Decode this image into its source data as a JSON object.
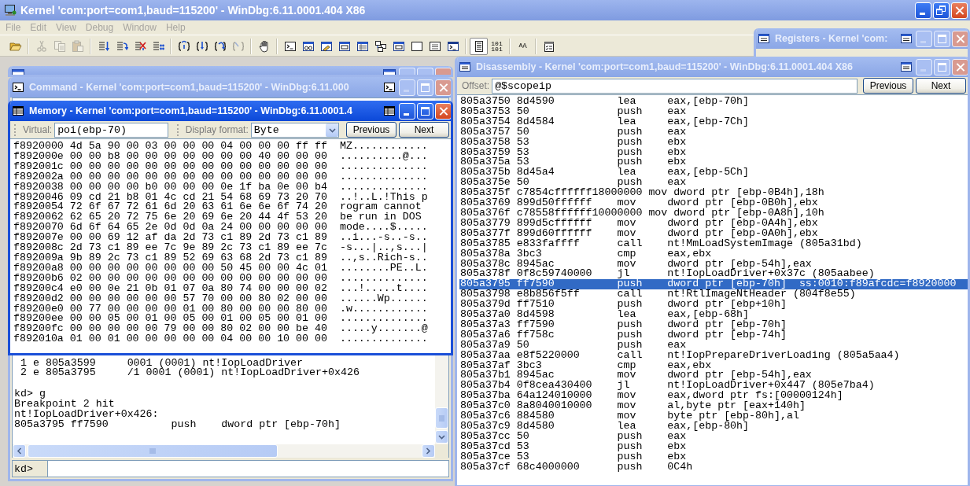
{
  "window": {
    "title": "Kernel 'com:port=com1,baud=115200' - WinDbg:6.11.0001.404 X86"
  },
  "menu": [
    "File",
    "Edit",
    "View",
    "Debug",
    "Window",
    "Help"
  ],
  "toolbar": [
    [
      {
        "disabled": false,
        "pressed": false
      }
    ],
    [
      {
        "disabled": true,
        "pressed": false
      },
      {
        "disabled": true,
        "pressed": false
      },
      {
        "disabled": true,
        "pressed": false
      }
    ],
    [
      {
        "disabled": false,
        "pressed": false
      },
      {
        "disabled": false,
        "pressed": false
      },
      {
        "disabled": false,
        "pressed": false
      },
      {
        "disabled": false,
        "pressed": false
      }
    ],
    [
      {
        "disabled": false,
        "pressed": false
      },
      {
        "disabled": false,
        "pressed": false
      },
      {
        "disabled": false,
        "pressed": false
      },
      {
        "disabled": true,
        "pressed": false
      }
    ],
    [
      {
        "disabled": false,
        "pressed": false
      }
    ],
    [
      {
        "disabled": false,
        "pressed": false
      },
      {
        "disabled": false,
        "pressed": false
      },
      {
        "disabled": false,
        "pressed": false
      },
      {
        "disabled": false,
        "pressed": false
      },
      {
        "disabled": false,
        "pressed": false
      },
      {
        "disabled": false,
        "pressed": false
      },
      {
        "disabled": false,
        "pressed": false
      },
      {
        "disabled": false,
        "pressed": false
      },
      {
        "disabled": false,
        "pressed": false
      },
      {
        "disabled": false,
        "pressed": false
      }
    ],
    [
      {
        "disabled": false,
        "pressed": true
      },
      {
        "disabled": false,
        "pressed": false,
        "text": "101 101"
      }
    ],
    [
      {
        "disabled": false,
        "pressed": false,
        "text": "A$_{A}$"
      }
    ],
    [
      {
        "disabled": false,
        "pressed": false
      }
    ]
  ],
  "scratch_pad": {
    "active": false
  },
  "command": {
    "title": "Command - Kernel 'com:port=com1,baud=115200' - WinDbg:6.11.000",
    "active": false,
    "output": [
      [
        " 1 e 805a3599     0001 (0001) nt!IopLoadDriver",
        " 2 e 805a3795     /1 0001 (0001) nt!IopLoadDriver+0x426"
      ],
      [
        "kd> g",
        "Breakpoint 2 hit",
        "nt!IopLoadDriver+0x426:",
        "805a3795 ff7590          push    dword ptr [ebp-70h]"
      ]
    ],
    "prompt": "kd>"
  },
  "memory": {
    "title": "Memory - Kernel 'com:port=com1,baud=115200' - WinDbg:6.11.0001.4",
    "active": true,
    "virtual_label": "Virtual:",
    "virtual": "poi(ebp-70)",
    "format_label": "Display format:",
    "format": "Byte",
    "buttons": [
      "Previous",
      "Next"
    ],
    "rows": [
      {
        "address": "f8920000",
        "bytes": "4d 5a 90 00 03 00 00 00 04 00 00 00 ff ff",
        "ascii": "MZ............"
      },
      {
        "address": "f892000e",
        "bytes": "00 00 b8 00 00 00 00 00 00 00 40 00 00 00",
        "ascii": "..........@..."
      },
      {
        "address": "f892001c",
        "bytes": "00 00 00 00 00 00 00 00 00 00 00 00 00 00",
        "ascii": ".............."
      },
      {
        "address": "f892002a",
        "bytes": "00 00 00 00 00 00 00 00 00 00 00 00 00 00",
        "ascii": ".............."
      },
      {
        "address": "f8920038",
        "bytes": "00 00 00 00 b0 00 00 00 0e 1f ba 0e 00 b4",
        "ascii": ".............."
      },
      {
        "address": "f8920046",
        "bytes": "09 cd 21 b8 01 4c cd 21 54 68 69 73 20 70",
        "ascii": "..!..L.!This p"
      },
      {
        "address": "f8920054",
        "bytes": "72 6f 67 72 61 6d 20 63 61 6e 6e 6f 74 20",
        "ascii": "rogram cannot"
      },
      {
        "address": "f8920062",
        "bytes": "62 65 20 72 75 6e 20 69 6e 20 44 4f 53 20",
        "ascii": "be run in DOS"
      },
      {
        "address": "f8920070",
        "bytes": "6d 6f 64 65 2e 0d 0d 0a 24 00 00 00 00 00",
        "ascii": "mode....$....."
      },
      {
        "address": "f892007e",
        "bytes": "00 00 69 12 af da 2d 73 c1 89 2d 73 c1 89",
        "ascii": "..i...-s..-s.."
      },
      {
        "address": "f892008c",
        "bytes": "2d 73 c1 89 ee 7c 9e 89 2c 73 c1 89 ee 7c",
        "ascii": "-s...|..,s...|"
      },
      {
        "address": "f892009a",
        "bytes": "9b 89 2c 73 c1 89 52 69 63 68 2d 73 c1 89",
        "ascii": "..,s..Rich-s.."
      },
      {
        "address": "f89200a8",
        "bytes": "00 00 00 00 00 00 00 00 50 45 00 00 4c 01",
        "ascii": "........PE..L."
      },
      {
        "address": "f89200b6",
        "bytes": "02 00 00 00 00 00 00 00 00 00 00 00 00 00",
        "ascii": ".............."
      },
      {
        "address": "f89200c4",
        "bytes": "e0 00 0e 21 0b 01 07 0a 80 74 00 00 00 02",
        "ascii": "...!.....t...."
      },
      {
        "address": "f89200d2",
        "bytes": "00 00 00 00 00 00 57 70 00 00 80 02 00 00",
        "ascii": "......Wp......"
      },
      {
        "address": "f89200e0",
        "bytes": "00 77 00 00 00 00 01 00 80 00 00 00 80 00",
        "ascii": ".w............"
      },
      {
        "address": "f89200ee",
        "bytes": "00 00 05 00 01 00 05 00 01 00 05 00 01 00",
        "ascii": ".............."
      },
      {
        "address": "f89200fc",
        "bytes": "00 00 00 00 00 79 00 00 80 02 00 00 be 40",
        "ascii": ".....y.......@"
      },
      {
        "address": "f892010a",
        "bytes": "01 00 01 00 00 00 00 00 04 00 00 10 00 00",
        "ascii": ".............."
      }
    ]
  },
  "registers": {
    "title": "Registers - Kernel 'com:",
    "active": false
  },
  "disassembly": {
    "title": "Disassembly - Kernel 'com:port=com1,baud=115200' - WinDbg:6.11.0001.404 X86",
    "active": false,
    "offset_label": "Offset:",
    "offset": "@$scopeip",
    "buttons": [
      "Previous",
      "Next"
    ],
    "rows": [
      {
        "address": "805a3750",
        "bytes": "8d4590",
        "mnemonic": "lea",
        "operands": "eax,[ebp-70h]",
        "selected": false
      },
      {
        "address": "805a3753",
        "bytes": "50",
        "mnemonic": "push",
        "operands": "eax",
        "selected": false
      },
      {
        "address": "805a3754",
        "bytes": "8d4584",
        "mnemonic": "lea",
        "operands": "eax,[ebp-7Ch]",
        "selected": false
      },
      {
        "address": "805a3757",
        "bytes": "50",
        "mnemonic": "push",
        "operands": "eax",
        "selected": false
      },
      {
        "address": "805a3758",
        "bytes": "53",
        "mnemonic": "push",
        "operands": "ebx",
        "selected": false
      },
      {
        "address": "805a3759",
        "bytes": "53",
        "mnemonic": "push",
        "operands": "ebx",
        "selected": false
      },
      {
        "address": "805a375a",
        "bytes": "53",
        "mnemonic": "push",
        "operands": "ebx",
        "selected": false
      },
      {
        "address": "805a375b",
        "bytes": "8d45a4",
        "mnemonic": "lea",
        "operands": "eax,[ebp-5Ch]",
        "selected": false
      },
      {
        "address": "805a375e",
        "bytes": "50",
        "mnemonic": "push",
        "operands": "eax",
        "selected": false
      },
      {
        "address": "805a375f",
        "bytes": "c7854cffffff18000000",
        "mnemonic": "mov",
        "operands": "dword ptr [ebp-0B4h],18h",
        "selected": false
      },
      {
        "address": "805a3769",
        "bytes": "899d50ffffff",
        "mnemonic": "mov",
        "operands": "dword ptr [ebp-0B0h],ebx",
        "selected": false
      },
      {
        "address": "805a376f",
        "bytes": "c78558ffffff10000000",
        "mnemonic": "mov",
        "operands": "dword ptr [ebp-0A8h],10h",
        "selected": false
      },
      {
        "address": "805a3779",
        "bytes": "899d5cffffff",
        "mnemonic": "mov",
        "operands": "dword ptr [ebp-0A4h],ebx",
        "selected": false
      },
      {
        "address": "805a377f",
        "bytes": "899d60ffffff",
        "mnemonic": "mov",
        "operands": "dword ptr [ebp-0A0h],ebx",
        "selected": false
      },
      {
        "address": "805a3785",
        "bytes": "e833faffff",
        "mnemonic": "call",
        "operands": "nt!MmLoadSystemImage (805a31bd)",
        "selected": false
      },
      {
        "address": "805a378a",
        "bytes": "3bc3",
        "mnemonic": "cmp",
        "operands": "eax,ebx",
        "selected": false
      },
      {
        "address": "805a378c",
        "bytes": "8945ac",
        "mnemonic": "mov",
        "operands": "dword ptr [ebp-54h],eax",
        "selected": false
      },
      {
        "address": "805a378f",
        "bytes": "0f8c59740000",
        "mnemonic": "jl",
        "operands": "nt!IopLoadDriver+0x37c (805aabee)",
        "selected": false
      },
      {
        "address": "805a3795",
        "bytes": "ff7590",
        "mnemonic": "push",
        "operands": "dword ptr [ebp-70h]",
        "annotation": "ss:0010:f89afcdc=f8920000",
        "selected": true
      },
      {
        "address": "805a3798",
        "bytes": "e8b856f5ff",
        "mnemonic": "call",
        "operands": "nt!RtlImageNtHeader (804f8e55)",
        "selected": false
      },
      {
        "address": "805a379d",
        "bytes": "ff7510",
        "mnemonic": "push",
        "operands": "dword ptr [ebp+10h]",
        "selected": false
      },
      {
        "address": "805a37a0",
        "bytes": "8d4598",
        "mnemonic": "lea",
        "operands": "eax,[ebp-68h]",
        "selected": false
      },
      {
        "address": "805a37a3",
        "bytes": "ff7590",
        "mnemonic": "push",
        "operands": "dword ptr [ebp-70h]",
        "selected": false
      },
      {
        "address": "805a37a6",
        "bytes": "ff758c",
        "mnemonic": "push",
        "operands": "dword ptr [ebp-74h]",
        "selected": false
      },
      {
        "address": "805a37a9",
        "bytes": "50",
        "mnemonic": "push",
        "operands": "eax",
        "selected": false
      },
      {
        "address": "805a37aa",
        "bytes": "e8f5220000",
        "mnemonic": "call",
        "operands": "nt!IopPrepareDriverLoading (805a5aa4)",
        "selected": false
      },
      {
        "address": "805a37af",
        "bytes": "3bc3",
        "mnemonic": "cmp",
        "operands": "eax,ebx",
        "selected": false
      },
      {
        "address": "805a37b1",
        "bytes": "8945ac",
        "mnemonic": "mov",
        "operands": "dword ptr [ebp-54h],eax",
        "selected": false
      },
      {
        "address": "805a37b4",
        "bytes": "0f8cea430400",
        "mnemonic": "jl",
        "operands": "nt!IopLoadDriver+0x447 (805e7ba4)",
        "selected": false
      },
      {
        "address": "805a37ba",
        "bytes": "64a124010000",
        "mnemonic": "mov",
        "operands": "eax,dword ptr fs:[00000124h]",
        "selected": false
      },
      {
        "address": "805a37c0",
        "bytes": "8a8040010000",
        "mnemonic": "mov",
        "operands": "al,byte ptr [eax+140h]",
        "selected": false
      },
      {
        "address": "805a37c6",
        "bytes": "884580",
        "mnemonic": "mov",
        "operands": "byte ptr [ebp-80h],al",
        "selected": false
      },
      {
        "address": "805a37c9",
        "bytes": "8d4580",
        "mnemonic": "lea",
        "operands": "eax,[ebp-80h]",
        "selected": false
      },
      {
        "address": "805a37cc",
        "bytes": "50",
        "mnemonic": "push",
        "operands": "eax",
        "selected": false
      },
      {
        "address": "805a37cd",
        "bytes": "53",
        "mnemonic": "push",
        "operands": "ebx",
        "selected": false
      },
      {
        "address": "805a37ce",
        "bytes": "53",
        "mnemonic": "push",
        "operands": "ebx",
        "selected": false
      },
      {
        "address": "805a37cf",
        "bytes": "68c4000000",
        "mnemonic": "push",
        "operands": "0C4h",
        "selected": false
      }
    ]
  }
}
